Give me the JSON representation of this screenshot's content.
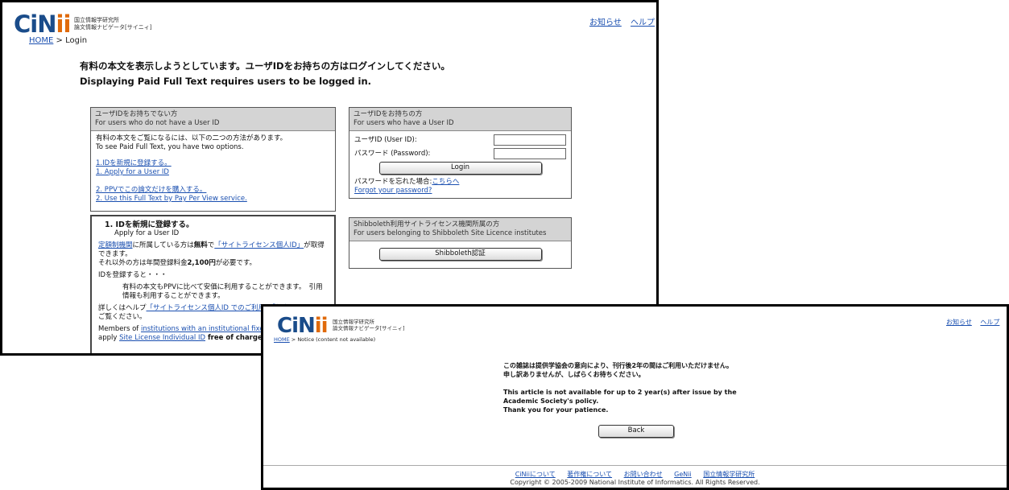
{
  "shot1": {
    "logo": {
      "ci": "CiN",
      "ii": "ii"
    },
    "logo_sub": [
      "国立情報学研究所",
      "論文情報ナビゲータ[サイニィ]"
    ],
    "toplinks": [
      "お知らせ",
      "ヘルプ"
    ],
    "breadcrumb": {
      "home": "HOME",
      "rest": " > Login"
    },
    "heading_ja": "有料の本文を表示しようとしています。ユーザIDをお持ちの方はログインしてください。",
    "heading_en": "Displaying Paid Full Text requires users to be logged in.",
    "left_panel": {
      "header1": "ユーザIDをお持ちでない方",
      "header2": "For users who do not have a User ID",
      "intro_ja": "有料の本文をご覧になるには、以下の二つの方法があります。",
      "intro_en": "To see Paid Full Text, you have two options.",
      "link1_ja": "1.IDを新規に登録する。",
      "link1_en": "1. Apply for a User ID",
      "link2_ja": "2. PPVでこの論文だけを購入する。",
      "link2_en": "2. Use this Full Text by Pay Per View service."
    },
    "detail_panel": {
      "title": "1. IDを新規に登録する。",
      "subtitle": "Apply for a User ID",
      "l1_link": "定額制機関",
      "l1_text": "に所属している方は",
      "l1_bold": "無料",
      "l1_text2": "で",
      "l1_link2": "「サイトライセンス個人ID」",
      "l1_text3": "が取得できます。",
      "l2": "それ以外の方は年間登録料金",
      "l2_bold": "2,100円",
      "l2_end": "が必要です。",
      "l3": "IDを登録すると・・・",
      "l4": "有料の本文もPPVに比べて安価に利用することができます。　引用情報も利用することができます。",
      "l5_text": "詳しくはヘルプ",
      "l5_link": "「サイトライセンス個人ID でのご利用」「個人",
      "l5_end": "ご覧ください。",
      "l6_text": "Members of ",
      "l6_link": "institutions with an institutional fixed-",
      "l7_text": "apply ",
      "l7_link": "Site License Individual ID",
      "l7_bold": " free of charge."
    },
    "login_panel": {
      "header1": "ユーザIDをお持ちの方",
      "header2": "For users who have a User ID",
      "userid_label": "ユーザID (User ID):",
      "password_label": "パスワード (Password):",
      "login_button": "Login",
      "forgot_ja": "パスワードを忘れた場合:",
      "forgot_ja_link": "こちらへ",
      "forgot_en": "Forgot your password?"
    },
    "shib_panel": {
      "header1": "Shibboleth利用サイトライセンス機関所属の方",
      "header2": "For users belonging to Shibboleth Site Licence institutes",
      "button": "Shibboleth認証"
    }
  },
  "shot2": {
    "logo": {
      "ci": "CiN",
      "ii": "ii"
    },
    "logo_sub": [
      "国立情報学研究所",
      "論文情報ナビゲータ[サイニィ]"
    ],
    "toplinks": [
      "お知らせ",
      "ヘルプ"
    ],
    "breadcrumb": {
      "home": "HOME",
      "rest": " > Notice (content not available)"
    },
    "msg_ja1": "この雑誌は提供学協会の意向により、刊行後2年の間はご利用いただけません。",
    "msg_ja2": "申し訳ありませんが、しばらくお待ちください。",
    "msg_en1": "This article is not available for up to 2 year(s) after issue by the",
    "msg_en2": "Academic Society's policy.",
    "msg_en3": "Thank you for your patience.",
    "back_button": "Back",
    "footer_links": [
      "CiNiiについて",
      "著作権について",
      "お問い合わせ",
      "GeNii",
      "国立情報学研究所"
    ],
    "copyright": "Copyright © 2005-2009 National Institute of Informatics. All Rights Reserved."
  }
}
